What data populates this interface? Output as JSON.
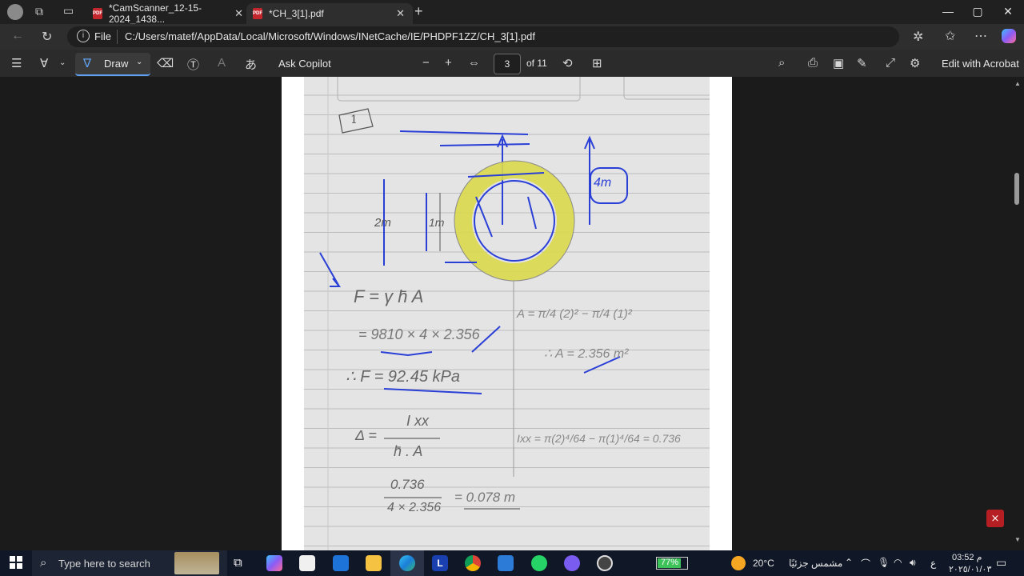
{
  "tabs": [
    {
      "label": "*CamScanner_12-15-2024_1438..."
    },
    {
      "label": "*CH_3[1].pdf"
    }
  ],
  "address": {
    "scheme_label": "File",
    "url": "C:/Users/matef/AppData/Local/Microsoft/Windows/INetCache/IE/PHDPF1ZZ/CH_3[1].pdf"
  },
  "toolbar": {
    "draw_label": "Draw",
    "ask_copilot_label": "Ask Copilot",
    "page_number": "3",
    "page_total": "of 11",
    "edit_acrobat_label": "Edit with Acrobat"
  },
  "doc": {
    "circle_label": "1",
    "dim_4m": "4m",
    "dim_2m": "2m",
    "dim_1m": "1m",
    "eq1": "F = γ h̄ A",
    "eq2": "= 9810 × 4 × 2.356",
    "eq3": "∴ F = 92.45 kPa",
    "area1": "A = π/4 (2)² − π/4 (1)²",
    "area2": "∴ A = 2.356 m²",
    "delta1_lhs": "Δ =",
    "delta1_num": "I xx",
    "delta1_den": "h̄ . A",
    "ixx": "Ixx = π(2)⁴/64 − π(1)⁴/64 = 0.736",
    "delta2_num": "0.736",
    "delta2_den": "4 × 2.356",
    "delta2_res": "= 0.078 m"
  },
  "taskbar": {
    "search_placeholder": "Type here to search",
    "battery": "77%",
    "temperature": "20°C",
    "weather_text": "مشمس جزئيًا",
    "lang": "ع",
    "time": "03:52 م",
    "date": "٢٠٢٥/٠١/٠٣"
  },
  "colors": {
    "accent": "#5ea0ef",
    "ink_blue": "#2a3fd6",
    "highlight": "#d9d84a",
    "acrobat_red": "#b51e22"
  }
}
